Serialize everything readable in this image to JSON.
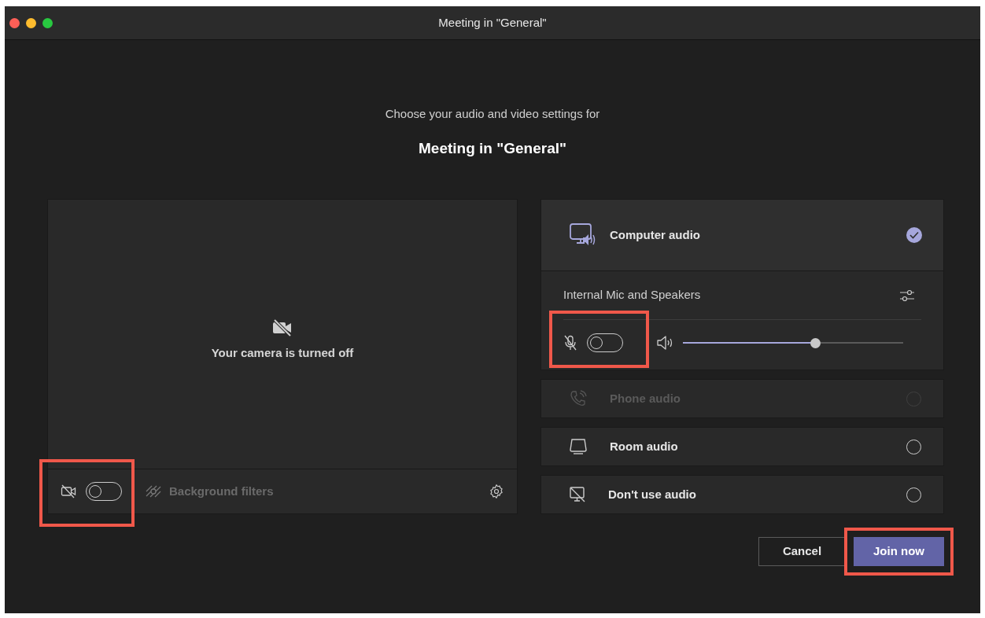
{
  "window": {
    "title": "Meeting in \"General\""
  },
  "heading": {
    "subtitle": "Choose your audio and video settings for",
    "title": "Meeting in \"General\""
  },
  "camera": {
    "message": "Your camera is turned off",
    "video_on": false,
    "highlighted": true
  },
  "background_filters": {
    "label": "Background filters",
    "disabled": true
  },
  "audio_options": [
    {
      "kind": "computer",
      "label": "Computer audio",
      "selected": true,
      "disabled": false
    },
    {
      "kind": "phone",
      "label": "Phone audio",
      "selected": false,
      "disabled": true
    },
    {
      "kind": "room",
      "label": "Room audio",
      "selected": false,
      "disabled": false
    },
    {
      "kind": "none",
      "label": "Don't use audio",
      "selected": false,
      "disabled": false
    }
  ],
  "device": {
    "name": "Internal Mic and Speakers",
    "mic_on": false,
    "highlighted": true,
    "volume": {
      "level": 0.6
    }
  },
  "buttons": [
    {
      "kind": "secondary",
      "label": "Cancel",
      "highlighted": false
    },
    {
      "kind": "primary",
      "label": "Join now",
      "highlighted": true
    }
  ]
}
